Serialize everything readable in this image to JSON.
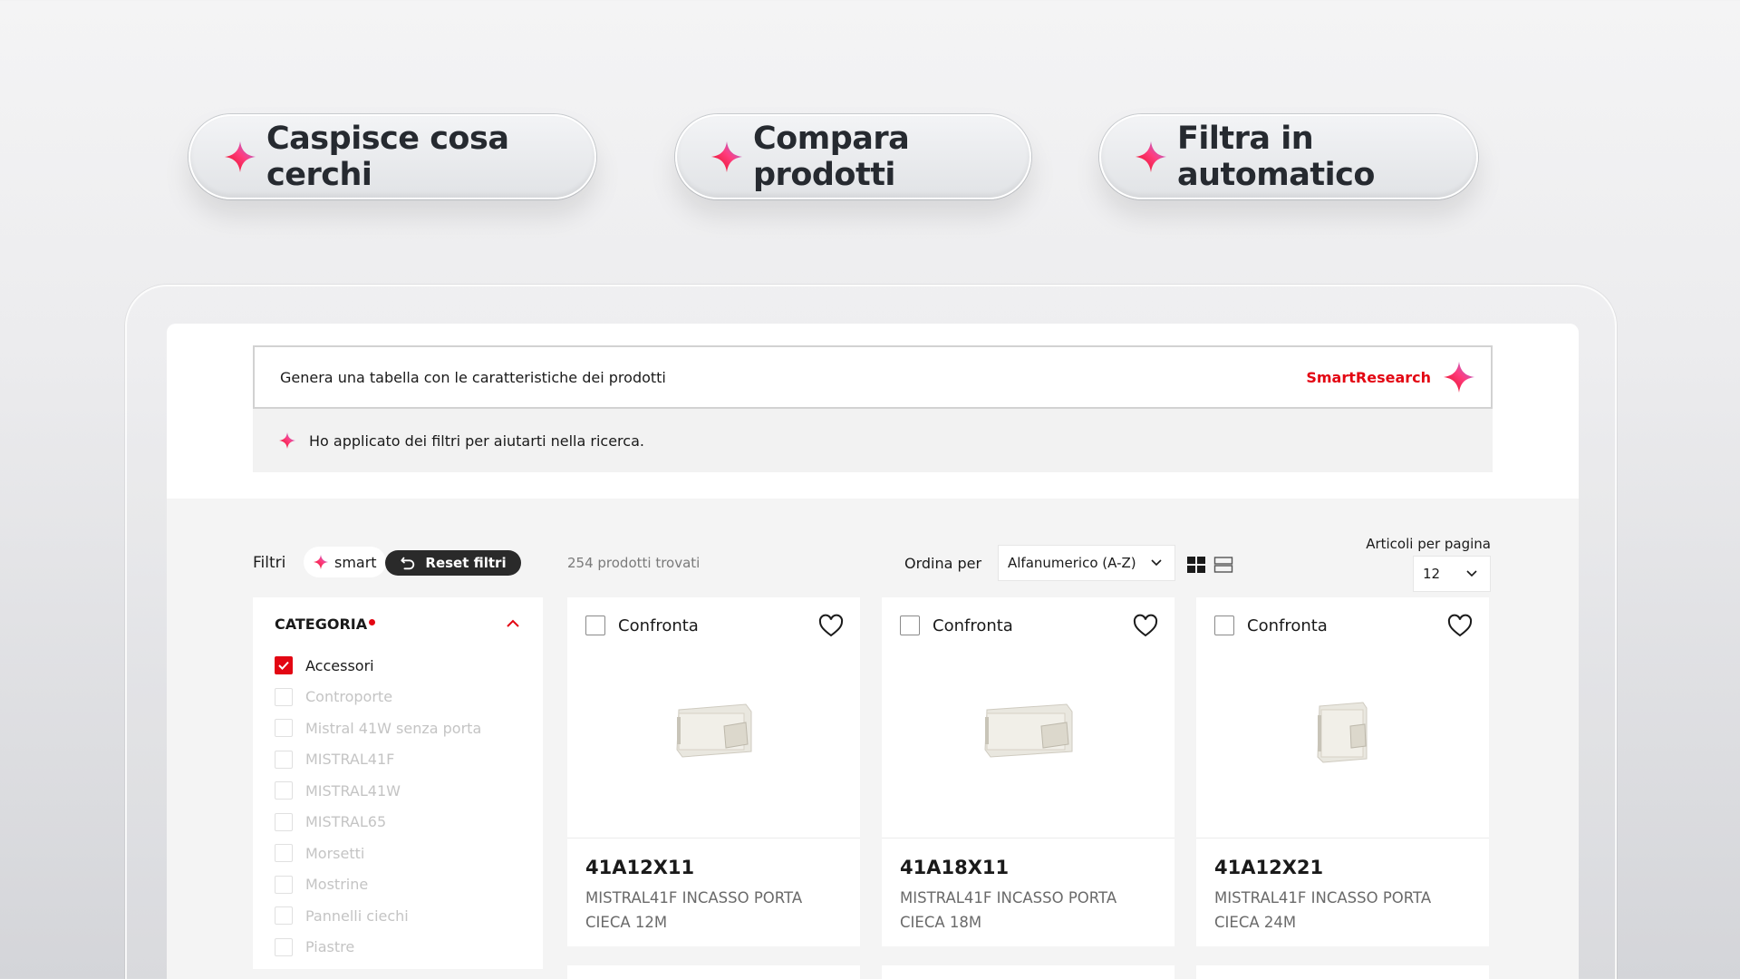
{
  "features": [
    {
      "label": "Caspisce cosa cerchi"
    },
    {
      "label": "Compara prodotti"
    },
    {
      "label": "Filtra in automatico"
    }
  ],
  "search": {
    "query": "Genera una tabella con le caratteristiche dei prodotti",
    "brand_label": "SmartResearch",
    "ai_message": "Ho applicato dei filtri per aiutarti nella ricerca."
  },
  "toolbar": {
    "filters_label": "Filtri",
    "smart_tag": "smart",
    "reset_label": "Reset filtri",
    "results_count": "254 prodotti trovati",
    "sort_label": "Ordina per",
    "sort_value": "Alfanumerico (A-Z)",
    "per_page_label": "Articoli per pagina",
    "per_page_value": "12"
  },
  "sidebar": {
    "category_heading": "CATEGORIA",
    "items": [
      {
        "label": "Accessori",
        "checked": true
      },
      {
        "label": "Controporte",
        "checked": false
      },
      {
        "label": "Mistral 41W senza porta",
        "checked": false
      },
      {
        "label": "MISTRAL41F",
        "checked": false
      },
      {
        "label": "MISTRAL41W",
        "checked": false
      },
      {
        "label": "MISTRAL65",
        "checked": false
      },
      {
        "label": "Morsetti",
        "checked": false
      },
      {
        "label": "Mostrine",
        "checked": false
      },
      {
        "label": "Pannelli ciechi",
        "checked": false
      },
      {
        "label": "Piastre",
        "checked": false
      }
    ]
  },
  "products": [
    {
      "compare_label": "Confronta",
      "code": "41A12X11",
      "description": "MISTRAL41F INCASSO PORTA CIECA 12M"
    },
    {
      "compare_label": "Confronta",
      "code": "41A18X11",
      "description": "MISTRAL41F INCASSO PORTA CIECA 18M"
    },
    {
      "compare_label": "Confronta",
      "code": "41A12X21",
      "description": "MISTRAL41F INCASSO PORTA CIECA 24M"
    }
  ],
  "colors": {
    "accent": "#e30613",
    "sparkle_pink": "#ff2d6f",
    "sparkle_purple": "#8b5cf6"
  }
}
